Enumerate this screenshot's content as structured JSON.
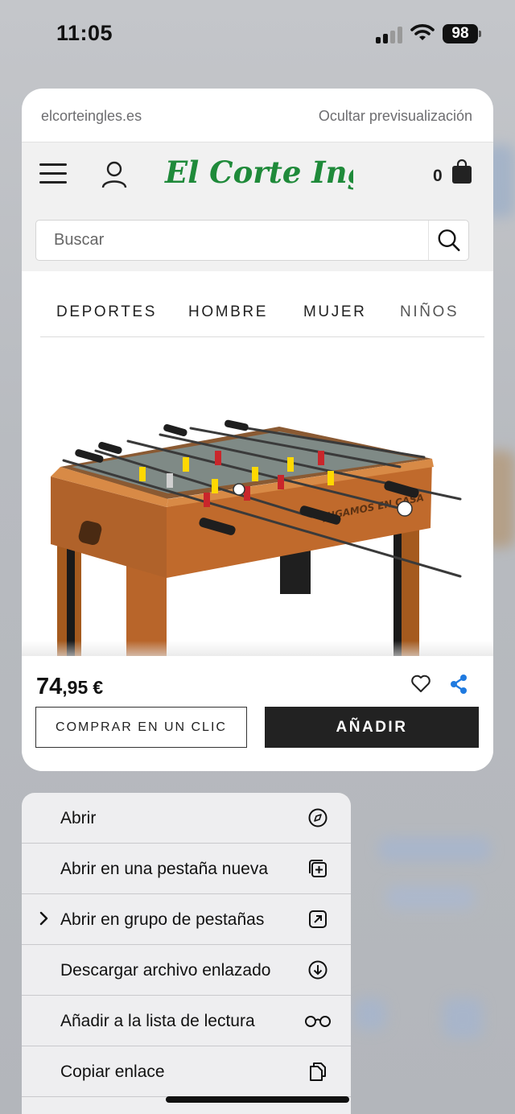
{
  "status_bar": {
    "time": "11:05",
    "battery": "98"
  },
  "preview": {
    "domain": "elcorteingles.es",
    "hide_label": "Ocultar previsualización"
  },
  "site": {
    "brand": "El Corte Inglés",
    "cart_count": "0",
    "search": {
      "placeholder": "Buscar"
    },
    "categories": [
      "DEPORTES",
      "HOMBRE",
      "MUJER",
      "NIÑOS"
    ]
  },
  "product": {
    "price_int": "74",
    "price_dec": ",95",
    "currency": "€",
    "image_text": "JUGAMOS EN CASA",
    "buy_one_click_label": "COMPRAR EN UN CLIC",
    "add_label": "AÑADIR"
  },
  "context_menu": {
    "items": [
      {
        "label": "Abrir",
        "icon": "compass-icon"
      },
      {
        "label": "Abrir en una pestaña nueva",
        "icon": "new-tab-icon"
      },
      {
        "label": "Abrir en grupo de pestañas",
        "icon": "tab-group-icon"
      },
      {
        "label": "Descargar archivo enlazado",
        "icon": "download-icon"
      },
      {
        "label": "Añadir a la lista de lectura",
        "icon": "glasses-icon"
      },
      {
        "label": "Copiar enlace",
        "icon": "copy-icon"
      }
    ]
  },
  "colors": {
    "brand_green": "#1f8a3a",
    "share_blue": "#1f7ae0",
    "button_dark": "#222222"
  }
}
